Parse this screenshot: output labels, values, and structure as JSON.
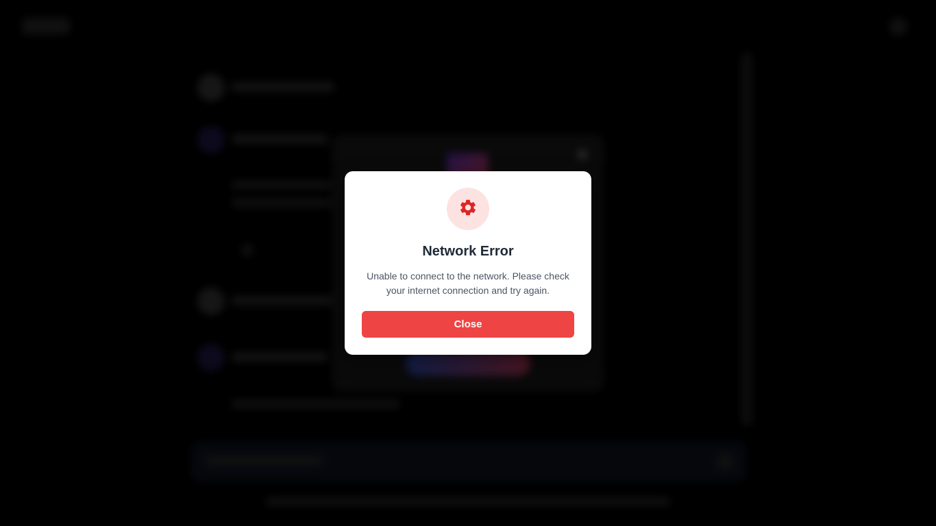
{
  "modal": {
    "icon": "gear-icon",
    "icon_color": "#dc2626",
    "icon_bg": "#fde2e2",
    "title": "Network Error",
    "message": "Unable to connect to the network. Please check your internet connection and try again.",
    "close_label": "Close",
    "accent": "#ef4444"
  }
}
